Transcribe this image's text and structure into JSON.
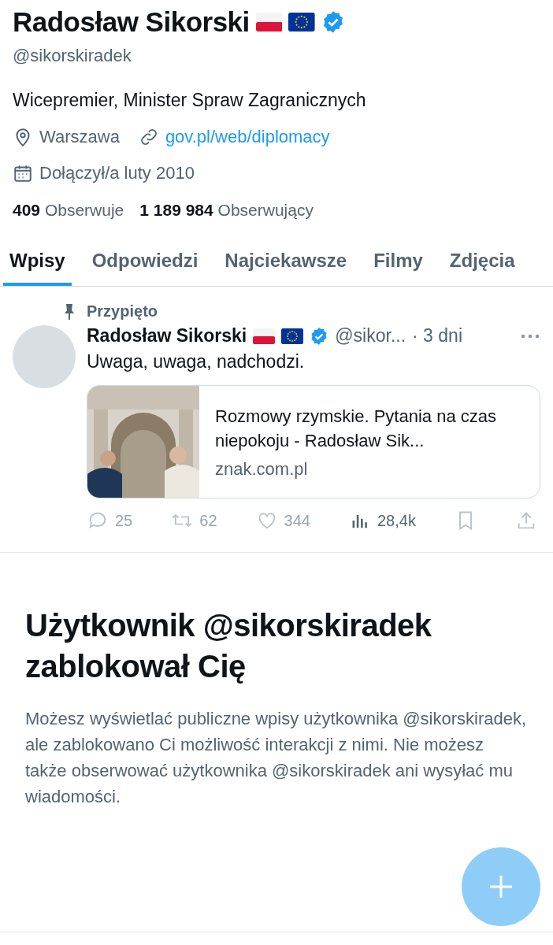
{
  "profile": {
    "name": "Radosław Sikorski",
    "flags": [
      {
        "kind": "pl"
      },
      {
        "kind": "eu"
      }
    ],
    "verified": true,
    "handle": "@sikorskiradek",
    "bio": "Wicepremier, Minister Spraw Zagranicznych",
    "location": "Warszawa",
    "website": "gov.pl/web/diplomacy",
    "joined": "Dołączył/a luty 2010",
    "following_count": "409",
    "following_label": "Obserwuje",
    "followers_count": "1 189 984",
    "followers_label": "Obserwujący"
  },
  "tabs": [
    {
      "label": "Wpisy",
      "selected": true
    },
    {
      "label": "Odpowiedzi",
      "selected": false
    },
    {
      "label": "Najciekawsze",
      "selected": false
    },
    {
      "label": "Filmy",
      "selected": false
    },
    {
      "label": "Zdjęcia",
      "selected": false
    }
  ],
  "pinned_tweet": {
    "pinned_label": "Przypięto",
    "author": "Radosław Sikorski",
    "flags": [
      {
        "kind": "pl"
      },
      {
        "kind": "eu"
      }
    ],
    "verified": true,
    "handle": "@sikor...",
    "time": "· 3 dni",
    "text": "Uwaga, uwaga, nadchodzi.",
    "card": {
      "title": "Rozmowy rzymskie. Pytania na czas niepokoju - Radosław Sik...",
      "domain": "znak.com.pl"
    },
    "actions": [
      {
        "kind": "reply",
        "count": "25",
        "disabled": true
      },
      {
        "kind": "retweet",
        "count": "62",
        "disabled": true
      },
      {
        "kind": "like",
        "count": "344",
        "disabled": true
      },
      {
        "kind": "views",
        "count": "28,4k",
        "disabled": false
      },
      {
        "kind": "bookmark",
        "disabled": true
      },
      {
        "kind": "share",
        "disabled": true
      }
    ]
  },
  "blocked_notice": {
    "title": "Użytkownik @sikorskiradek zablokował Cię",
    "body": "Możesz wyświetlać publiczne wpisy użytkownika @sikorskiradek, ale zablokowano Ci możliwość interakcji z nimi. Nie możesz także obserwować użytkownika @sikorskiradek ani wysyłać mu wiadomości."
  },
  "compose_button": {
    "disabled": true
  }
}
